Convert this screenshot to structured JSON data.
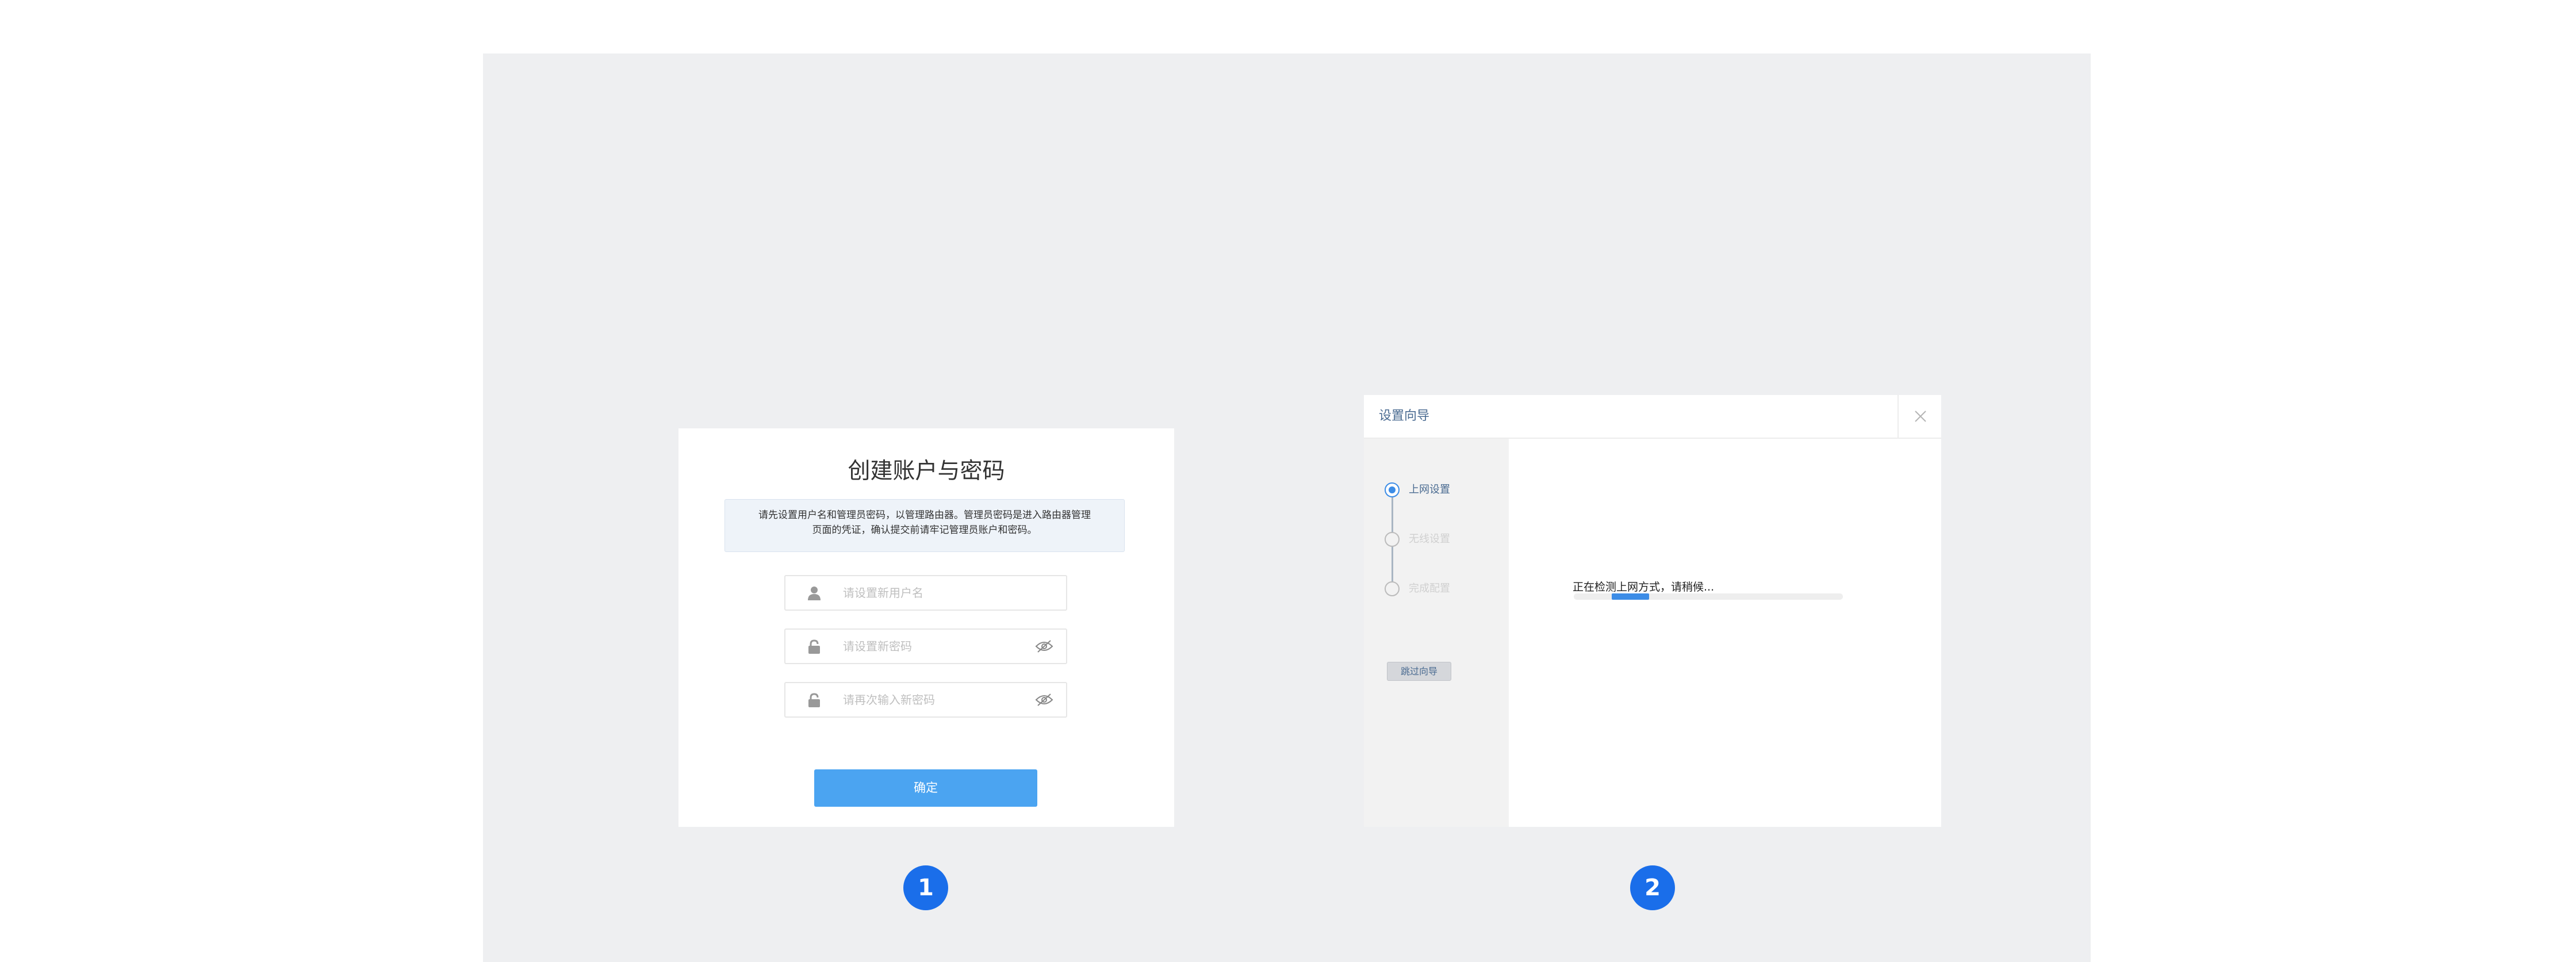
{
  "panel1": {
    "title": "创建账户与密码",
    "notice_line1": "请先设置用户名和管理员密码，以管理路由器。管理员密码是进入路由器管理",
    "notice_line2": "页面的凭证，确认提交前请牢记管理员账户和密码。",
    "username_placeholder": "请设置新用户名",
    "password_placeholder": "请设置新密码",
    "confirm_placeholder": "请再次输入新密码",
    "confirm_button": "确定",
    "icons": [
      "user-icon",
      "lock-icon",
      "eye-hidden-icon"
    ]
  },
  "panel2": {
    "title": "设置向导",
    "steps": [
      {
        "label": "上网设置",
        "active": true
      },
      {
        "label": "无线设置",
        "active": false
      },
      {
        "label": "完成配置",
        "active": false
      }
    ],
    "skip_button": "跳过向导",
    "status_text": "正在检测上网方式，请稍候...",
    "progress": {
      "start": 0.14,
      "end": 0.28
    },
    "icons": [
      "close-icon"
    ]
  },
  "badges": [
    "1",
    "2"
  ],
  "colors": {
    "accent": "#4ba4f1",
    "primary": "#3c8ce6",
    "badge": "#1a6eea",
    "background": "#eeeff1"
  }
}
